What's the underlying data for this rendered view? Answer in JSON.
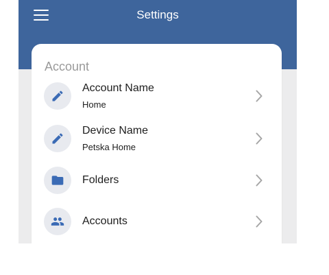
{
  "header": {
    "title": "Settings",
    "menu_icon": "hamburger-menu-icon",
    "background_color": "#3e659c"
  },
  "section": {
    "title": "Account"
  },
  "rows": [
    {
      "label": "Account Name",
      "sublabel": "Home",
      "icon": "pencil-icon"
    },
    {
      "label": "Device Name",
      "sublabel": "Petska Home",
      "icon": "pencil-icon"
    },
    {
      "label": "Folders",
      "icon": "folder-icon"
    },
    {
      "label": "Accounts",
      "icon": "people-icon"
    }
  ],
  "colors": {
    "accent": "#3e659c",
    "icon_fill": "#3b6bb5",
    "icon_bg": "#e8eaef",
    "chevron": "#a6a6a6"
  }
}
